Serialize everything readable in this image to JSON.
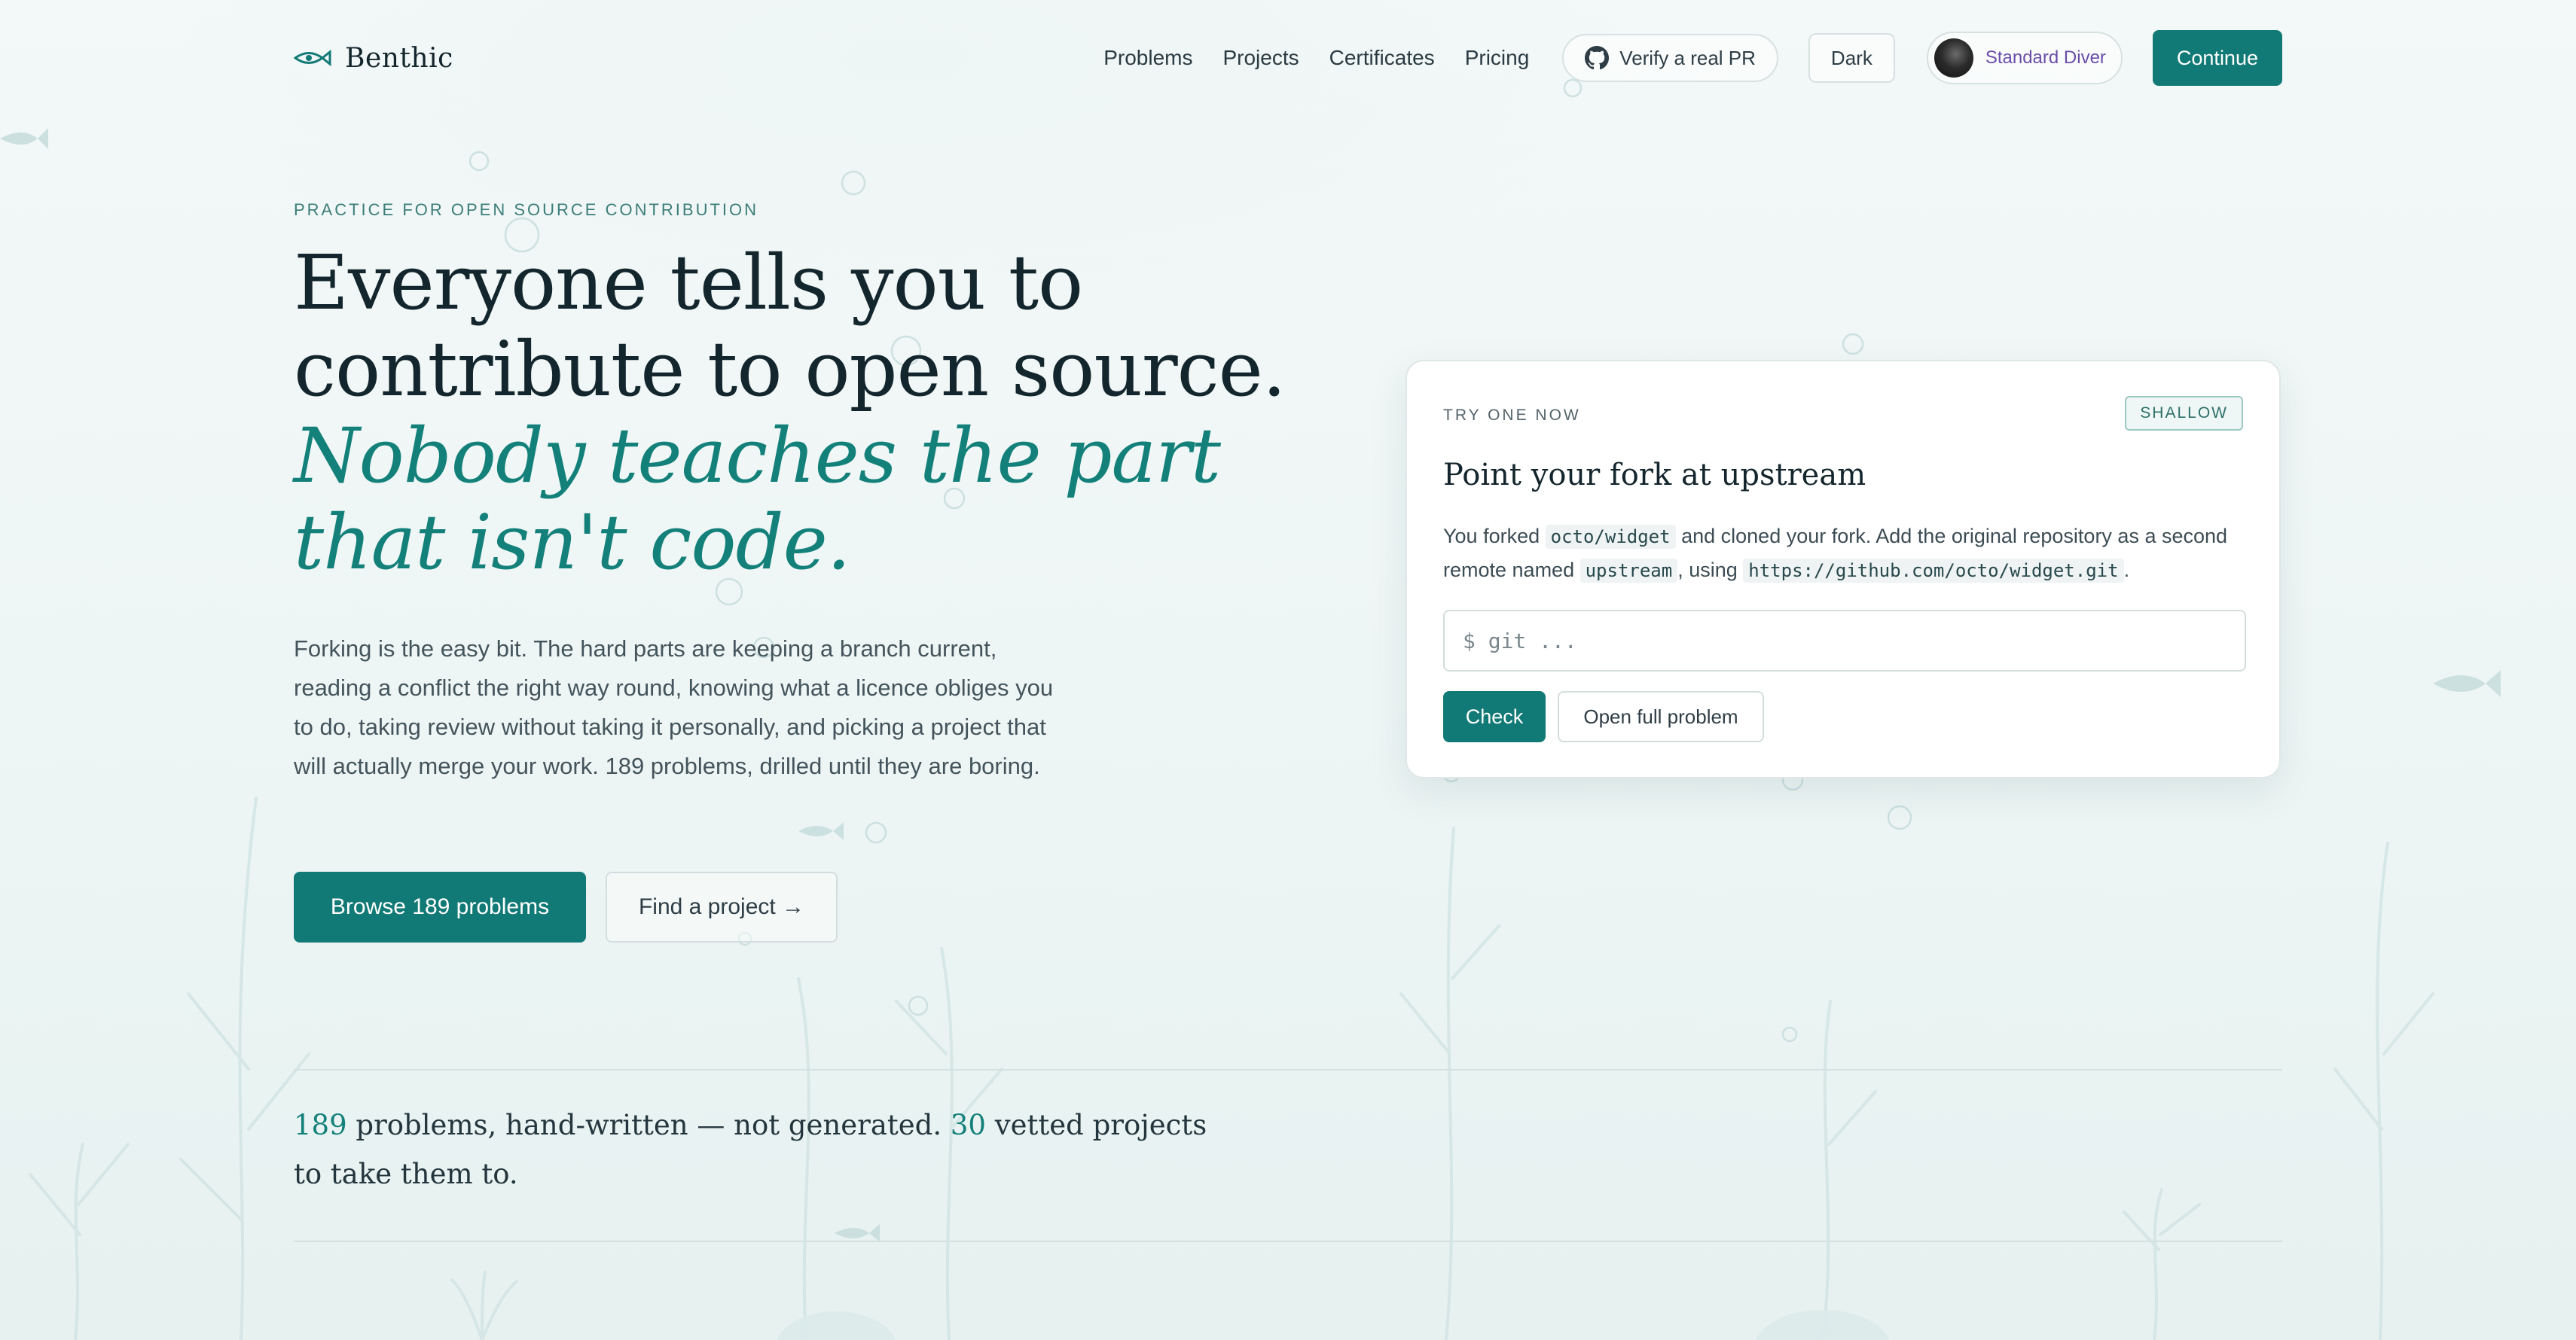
{
  "nav": {
    "brand": "Benthic",
    "links": [
      "Problems",
      "Projects",
      "Certificates",
      "Pricing"
    ],
    "verify_label": "Verify a real PR",
    "theme_label": "Dark",
    "user_name": "Standard Diver",
    "continue_label": "Continue"
  },
  "hero": {
    "eyebrow": "PRACTICE FOR OPEN SOURCE CONTRIBUTION",
    "headline_line1": "Everyone tells you to",
    "headline_line2": "contribute to open source.",
    "accent_line1": "Nobody teaches the part",
    "accent_line2": "that isn't code.",
    "lede": "Forking is the easy bit. The hard parts are keeping a branch current, reading a conflict the right way round, knowing what a licence obliges you to do, taking review without taking it personally, and picking a project that will actually merge your work. 189 problems, drilled until they are boring.",
    "primary_cta": "Browse 189 problems",
    "secondary_cta": "Find a project →"
  },
  "card": {
    "eyebrow": "TRY ONE NOW",
    "badge": "SHALLOW",
    "title": "Point your fork at upstream",
    "desc_1": "You forked",
    "code_repo": "octo/widget",
    "desc_2": "and cloned your fork. Add the original repository as a second remote named",
    "code_remote": "upstream",
    "desc_3": ", using",
    "code_url": "https://github.com/octo/widget.git",
    "desc_4": ".",
    "input_placeholder": "$ git ...",
    "check_label": "Check",
    "open_label": "Open full problem"
  },
  "stats": {
    "problems_count": "189",
    "problems_text": " problems, hand-written — not generated. ",
    "projects_count": "30",
    "projects_text": " vetted projects to take them to."
  },
  "colors": {
    "accent": "#127a76",
    "accent_text": "#13807a",
    "user_name": "#6a4da8",
    "background": "#f0f7f6"
  },
  "icons": {
    "brand": "fish-eye-icon",
    "verify": "github-icon"
  }
}
